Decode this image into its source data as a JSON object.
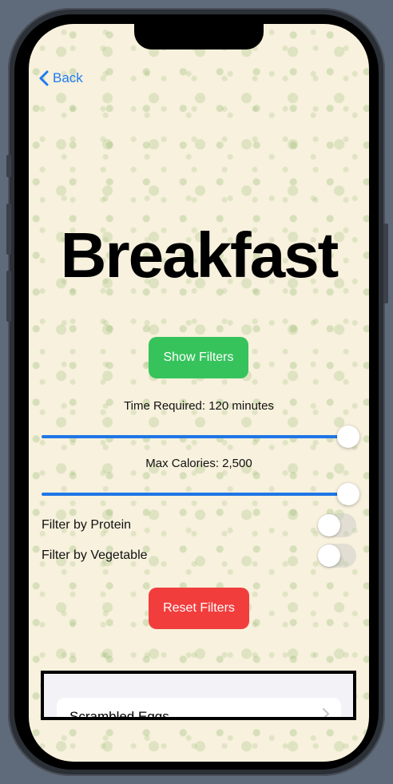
{
  "nav": {
    "back_label": "Back"
  },
  "page": {
    "title": "Breakfast"
  },
  "filters": {
    "show_label": "Show Filters",
    "reset_label": "Reset Filters",
    "time_label": "Time Required: 120 minutes",
    "time_slider_fraction": 1.0,
    "calories_label": "Max Calories: 2,500",
    "calories_slider_fraction": 1.0,
    "protein_label": "Filter by Protein",
    "protein_on": false,
    "vegetable_label": "Filter by Vegetable",
    "vegetable_on": false
  },
  "recipes": [
    {
      "name": "Scrambled Eggs"
    }
  ],
  "colors": {
    "accent_blue": "#1e7bf2",
    "show_button": "#36c35c",
    "reset_button": "#f23d3d",
    "slider_fill": "#1f76e6",
    "background": "#f7f1dd"
  },
  "icons": [
    "back-chevron-icon",
    "chevron-right-icon"
  ]
}
